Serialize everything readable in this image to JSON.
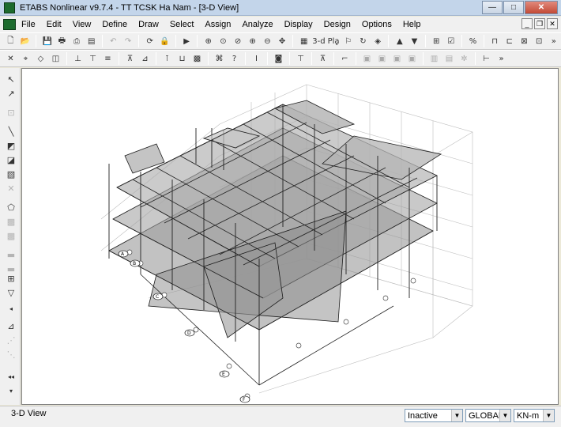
{
  "window": {
    "title": "ETABS Nonlinear v9.7.4 - TT TCSK Ha Nam - [3-D View]"
  },
  "menu": [
    "File",
    "Edit",
    "View",
    "Define",
    "Draw",
    "Select",
    "Assign",
    "Analyze",
    "Display",
    "Design",
    "Options",
    "Help"
  ],
  "toolbar": {
    "label_3d": "3-d",
    "label_pl": "Plḁ"
  },
  "status": {
    "view_name": "3-D View",
    "mode": "Inactive",
    "coord_system": "GLOBAL",
    "units": "KN-m"
  },
  "grid_bubbles": [
    "A",
    "B",
    "C",
    "D",
    "E",
    "F"
  ],
  "colors": {
    "floor_fill": "#9a9a9a",
    "frame": "#1a1a1a",
    "grid": "#b4b4b4"
  }
}
